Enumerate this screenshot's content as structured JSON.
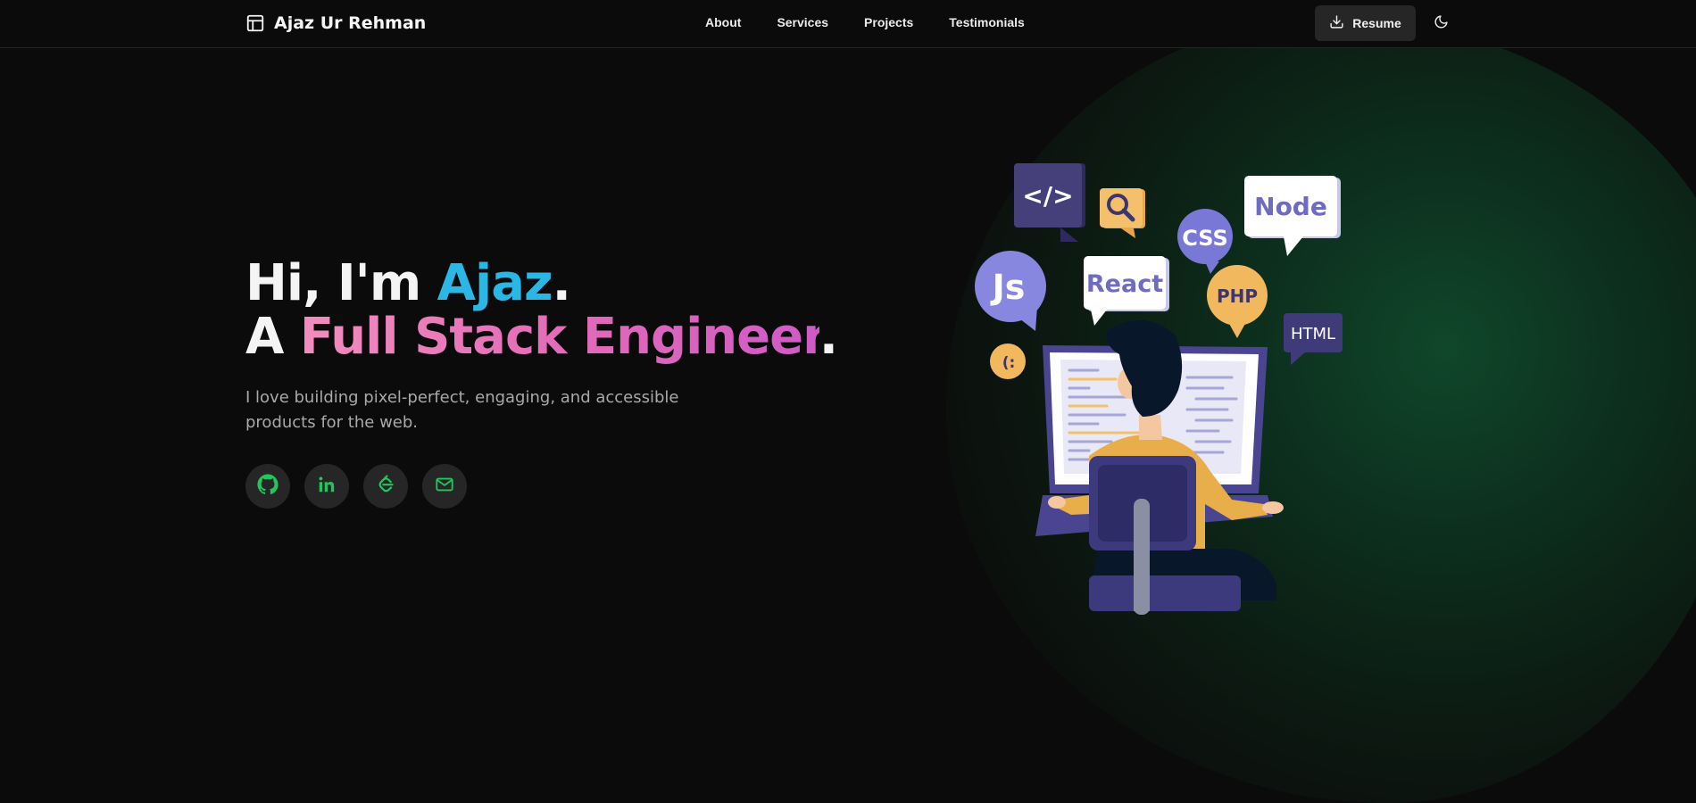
{
  "brand": {
    "name": "Ajaz Ur Rehman",
    "icon": "layout-icon"
  },
  "nav": [
    {
      "label": "About"
    },
    {
      "label": "Services"
    },
    {
      "label": "Projects"
    },
    {
      "label": "Testimonials"
    }
  ],
  "header_actions": {
    "resume_label": "Resume",
    "resume_icon": "download-icon",
    "theme_icon": "moon-icon"
  },
  "hero": {
    "greeting_prefix": "Hi, I'm ",
    "name": "Ajaz",
    "period": ".",
    "role_prefix": "A ",
    "role": "Full Stack Engineer",
    "tagline": "I love building pixel-perfect, engaging, and accessible products for the web."
  },
  "socials": [
    {
      "icon": "github-icon"
    },
    {
      "icon": "linkedin-icon"
    },
    {
      "icon": "leetcode-icon"
    },
    {
      "icon": "mail-icon"
    }
  ],
  "illustration": {
    "bubbles": {
      "code": "</>",
      "css": "CSS",
      "node": "Node",
      "js": "Js",
      "react": "React",
      "php": "PHP",
      "html": "HTML",
      "smile": "(:"
    }
  },
  "colors": {
    "background": "#0b0b0b",
    "accent_name": "#2bb7e6",
    "accent_role": "#e36bb8",
    "icon_green": "#22c55e",
    "glow": "#10472a",
    "button_bg": "#262626"
  }
}
